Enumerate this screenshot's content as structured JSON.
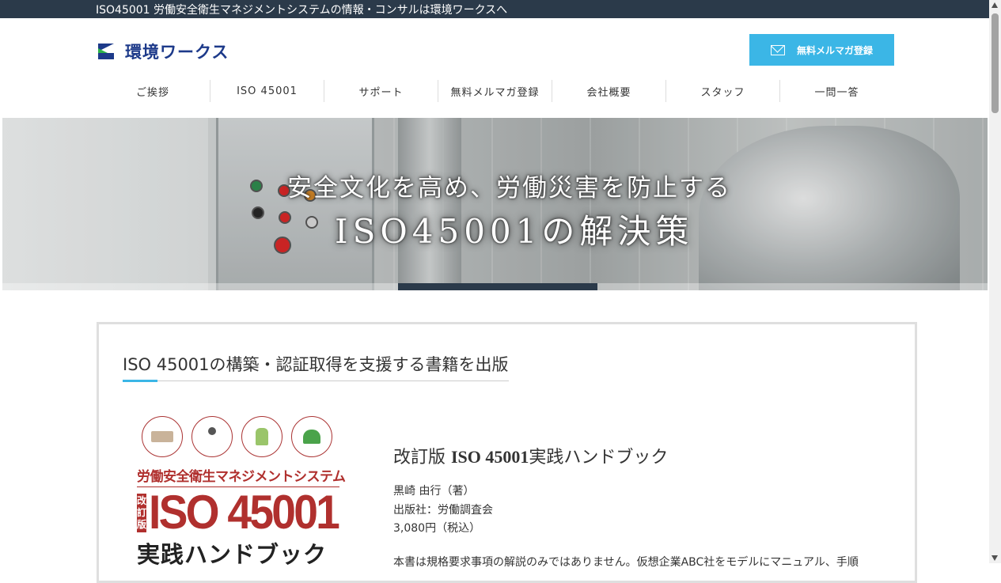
{
  "topbar": {
    "text": "ISO45001 労働安全衛生マネジメントシステムの情報・コンサルは環境ワークスへ"
  },
  "header": {
    "logo_text": "環境ワークス",
    "mag_button_label": "無料メルマガ登録"
  },
  "nav": {
    "items": [
      {
        "label": "ご挨拶"
      },
      {
        "label": "ISO 45001"
      },
      {
        "label": "サポート"
      },
      {
        "label": "無料メルマガ登録"
      },
      {
        "label": "会社概要"
      },
      {
        "label": "スタッフ"
      },
      {
        "label": "一問一答"
      }
    ]
  },
  "hero": {
    "line1": "安全文化を高め、労働災害を防止する",
    "line2": "ISO45001の解決策",
    "slide_active_index": 1,
    "slide_count": 5
  },
  "section": {
    "heading": "ISO 45001の構築・認証取得を支援する書籍を出版"
  },
  "book": {
    "cover": {
      "subtitle": "労働安全衛生マネジメントシステム",
      "edition_mark": "改訂版",
      "title_big": "ISO 45001",
      "title_bottom": "実践ハンドブック"
    },
    "title_prefix": "改訂版 ",
    "title_main": "ISO 45001",
    "title_suffix": "実践ハンドブック",
    "author": "黒崎 由行（著）",
    "publisher": "出版社：労働調査会",
    "price": "3,080円（税込）",
    "description": "本書は規格要求事項の解説のみではありません。仮想企業ABC社をモデルにマニュアル、手順"
  },
  "colors": {
    "topbar": "#2b3a4a",
    "accent": "#3bb6e6",
    "brand": "#1d3a8a",
    "cover_red": "#b0302e"
  }
}
